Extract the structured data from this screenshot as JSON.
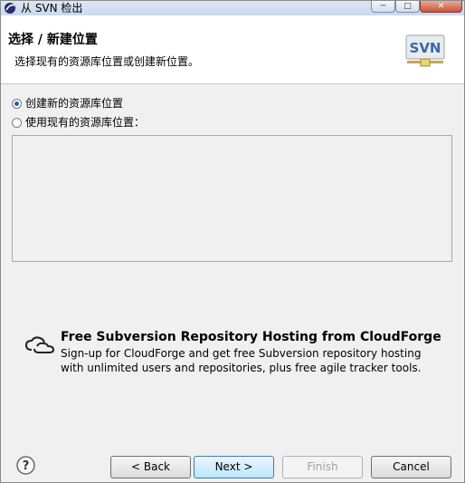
{
  "window": {
    "title": "从 SVN 检出",
    "min_glyph": "─",
    "max_glyph": "□",
    "close_glyph": "✕"
  },
  "header": {
    "title": "选择 / 新建位置",
    "description": "选择现有的资源库位置或创建新位置。",
    "logo_text": "SVN"
  },
  "options": {
    "create_new": "创建新的资源库位置",
    "use_existing": "使用现有的资源库位置：",
    "selected": "create_new"
  },
  "promo": {
    "title": "Free Subversion Repository Hosting from CloudForge",
    "line1": "Sign-up for CloudForge and get free Subversion repository hosting",
    "line2": "with unlimited users and repositories, plus free agile tracker tools."
  },
  "footer": {
    "back_label": "< Back",
    "next_label": "Next >",
    "finish_label": "Finish",
    "cancel_label": "Cancel",
    "finish_enabled": false
  },
  "colors": {
    "accent": "#3c7fb1",
    "radio_dot": "#2b5fa6"
  }
}
